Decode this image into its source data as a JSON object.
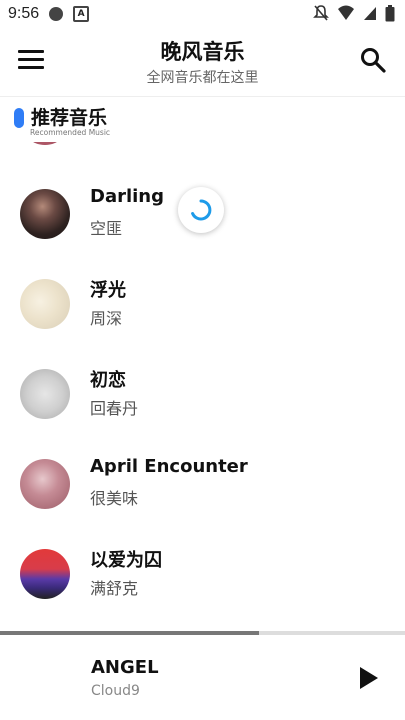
{
  "status_bar": {
    "time": "9:56"
  },
  "header": {
    "title": "晚风音乐",
    "subtitle": "全网音乐都在这里"
  },
  "section": {
    "title": "推荐音乐",
    "subtitle": "Recommended Music"
  },
  "list": {
    "items": [
      {
        "title": "Darling",
        "artist": "空匪"
      },
      {
        "title": "浮光",
        "artist": "周深"
      },
      {
        "title": "初恋",
        "artist": "回春丹"
      },
      {
        "title": "April Encounter",
        "artist": "很美味"
      },
      {
        "title": "以爱为囚",
        "artist": "满舒克"
      }
    ]
  },
  "player": {
    "title": "ANGEL",
    "artist": "Cloud9",
    "progress": 0.64
  },
  "colors": {
    "accent": "#2f7df6",
    "spinner": "#1e9be9"
  }
}
